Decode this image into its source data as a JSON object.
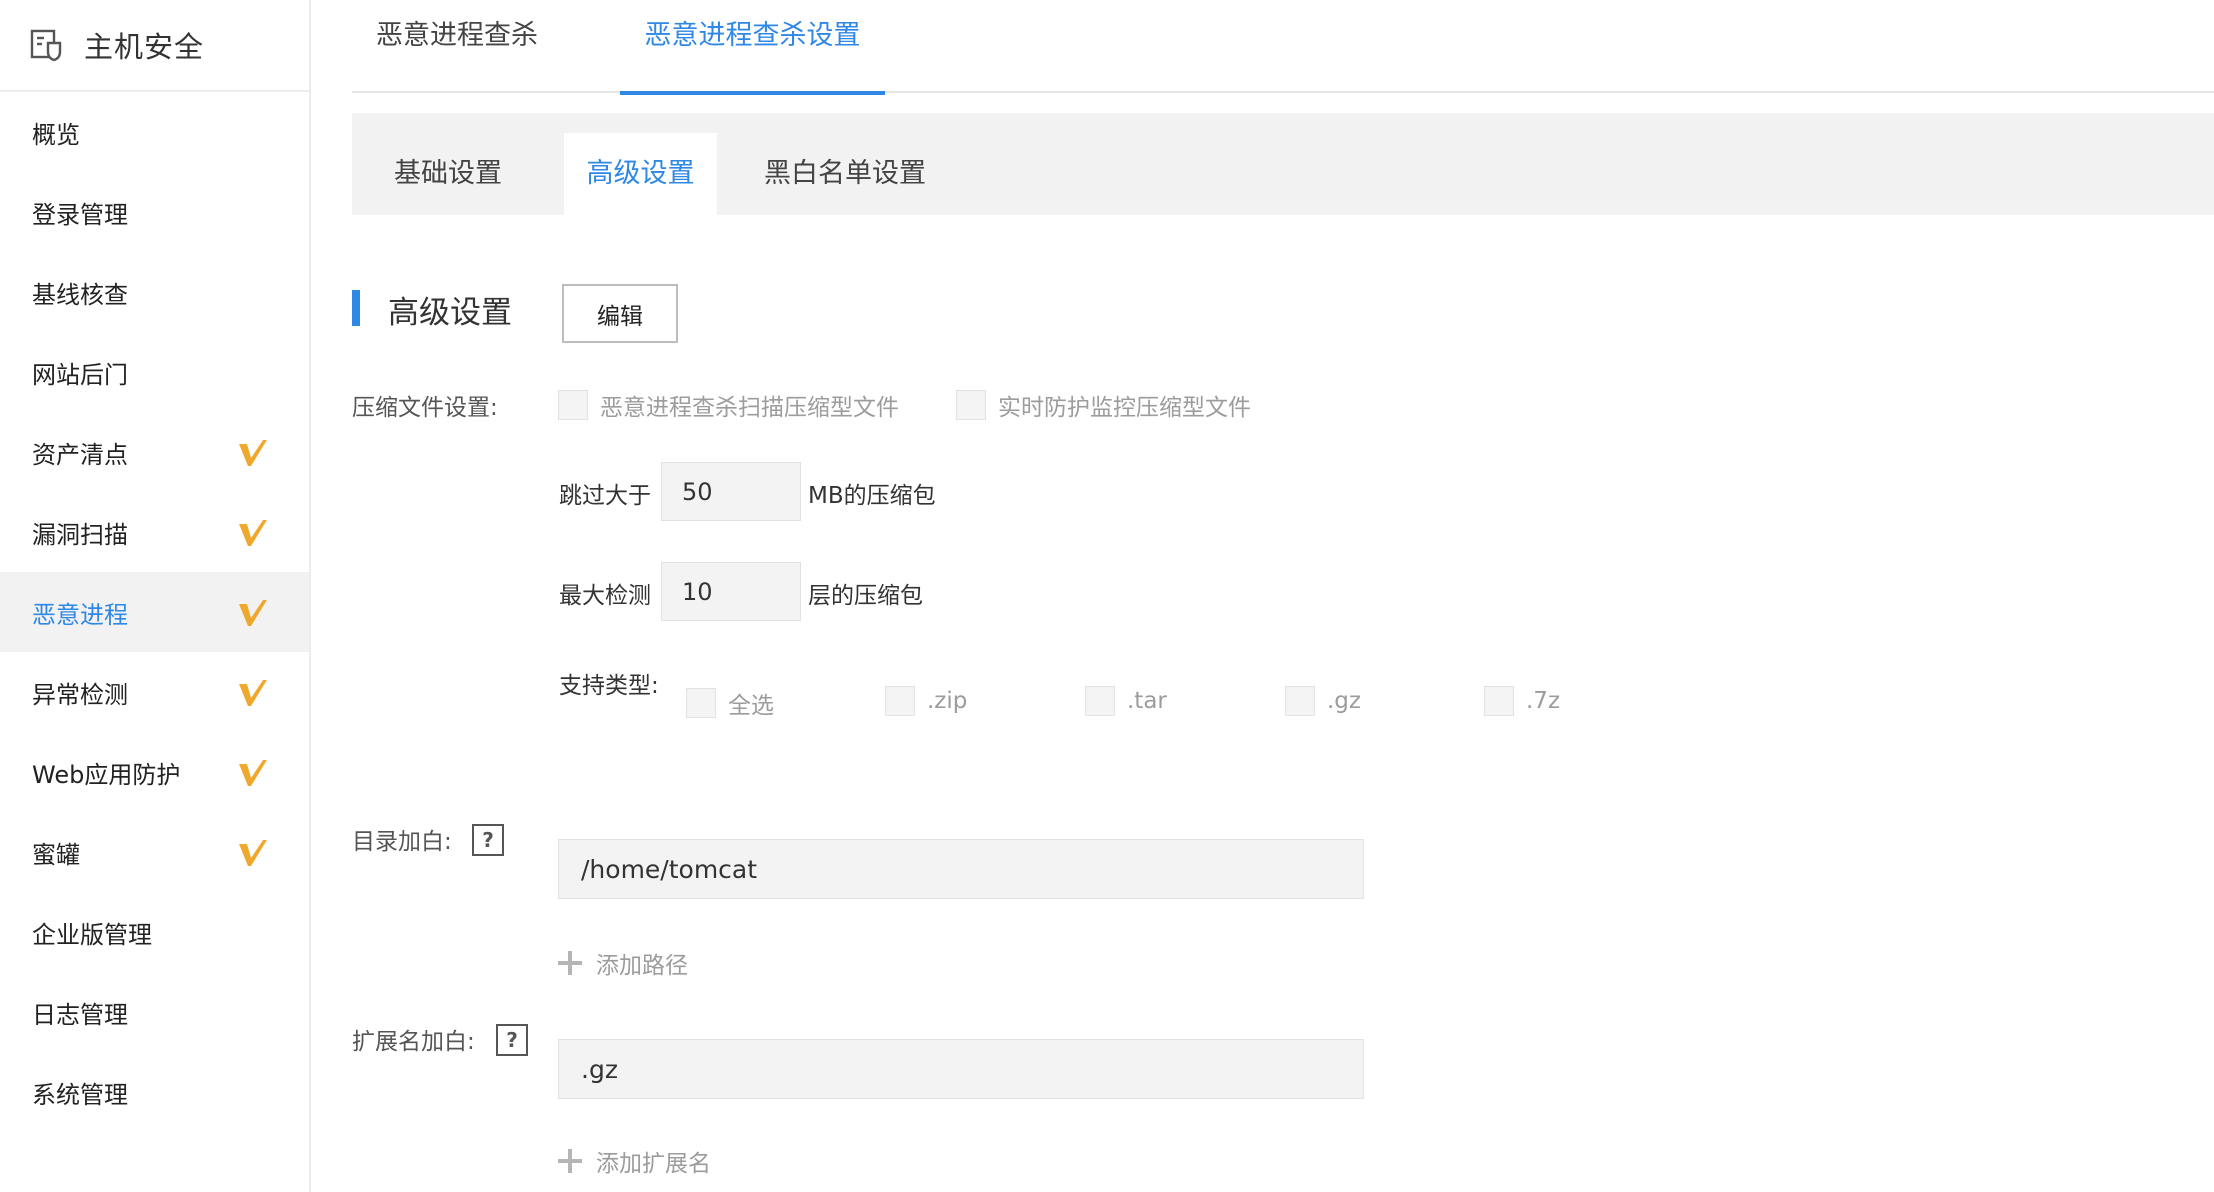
{
  "sidebar": {
    "title": "主机安全",
    "items": [
      {
        "label": "概览",
        "badge": false,
        "active": false
      },
      {
        "label": "登录管理",
        "badge": false,
        "active": false
      },
      {
        "label": "基线核查",
        "badge": false,
        "active": false
      },
      {
        "label": "网站后门",
        "badge": false,
        "active": false
      },
      {
        "label": "资产清点",
        "badge": true,
        "active": false
      },
      {
        "label": "漏洞扫描",
        "badge": true,
        "active": false
      },
      {
        "label": "恶意进程",
        "badge": true,
        "active": true
      },
      {
        "label": "异常检测",
        "badge": true,
        "active": false
      },
      {
        "label": "Web应用防护",
        "badge": true,
        "active": false
      },
      {
        "label": "蜜罐",
        "badge": true,
        "active": false
      },
      {
        "label": "企业版管理",
        "badge": false,
        "active": false
      },
      {
        "label": "日志管理",
        "badge": false,
        "active": false
      },
      {
        "label": "系统管理",
        "badge": false,
        "active": false
      }
    ]
  },
  "top_tabs": [
    {
      "label": "恶意进程查杀",
      "active": false
    },
    {
      "label": "恶意进程查杀设置",
      "active": true
    }
  ],
  "sub_tabs": [
    {
      "label": "基础设置",
      "active": false
    },
    {
      "label": "高级设置",
      "active": true
    },
    {
      "label": "黑白名单设置",
      "active": false
    }
  ],
  "section": {
    "title": "高级设置",
    "edit_label": "编辑"
  },
  "compress": {
    "label": "压缩文件设置:",
    "option1": "恶意进程查杀扫描压缩型文件",
    "option2": "实时防护监控压缩型文件",
    "skip_prefix": "跳过大于",
    "skip_value": "50",
    "skip_suffix": "MB的压缩包",
    "depth_prefix": "最大检测",
    "depth_value": "10",
    "depth_suffix": "层的压缩包",
    "types_label": "支持类型:",
    "types": [
      "全选",
      ".zip",
      ".tar",
      ".gz",
      ".7z"
    ]
  },
  "dir_whitelist": {
    "label": "目录加白:",
    "help": "?",
    "value": "/home/tomcat",
    "add_label": "添加路径"
  },
  "ext_whitelist": {
    "label": "扩展名加白:",
    "help": "?",
    "value": ".gz",
    "add_label": "添加扩展名"
  },
  "colors": {
    "accent": "#2f88e6",
    "badge": "#f0a82c"
  }
}
